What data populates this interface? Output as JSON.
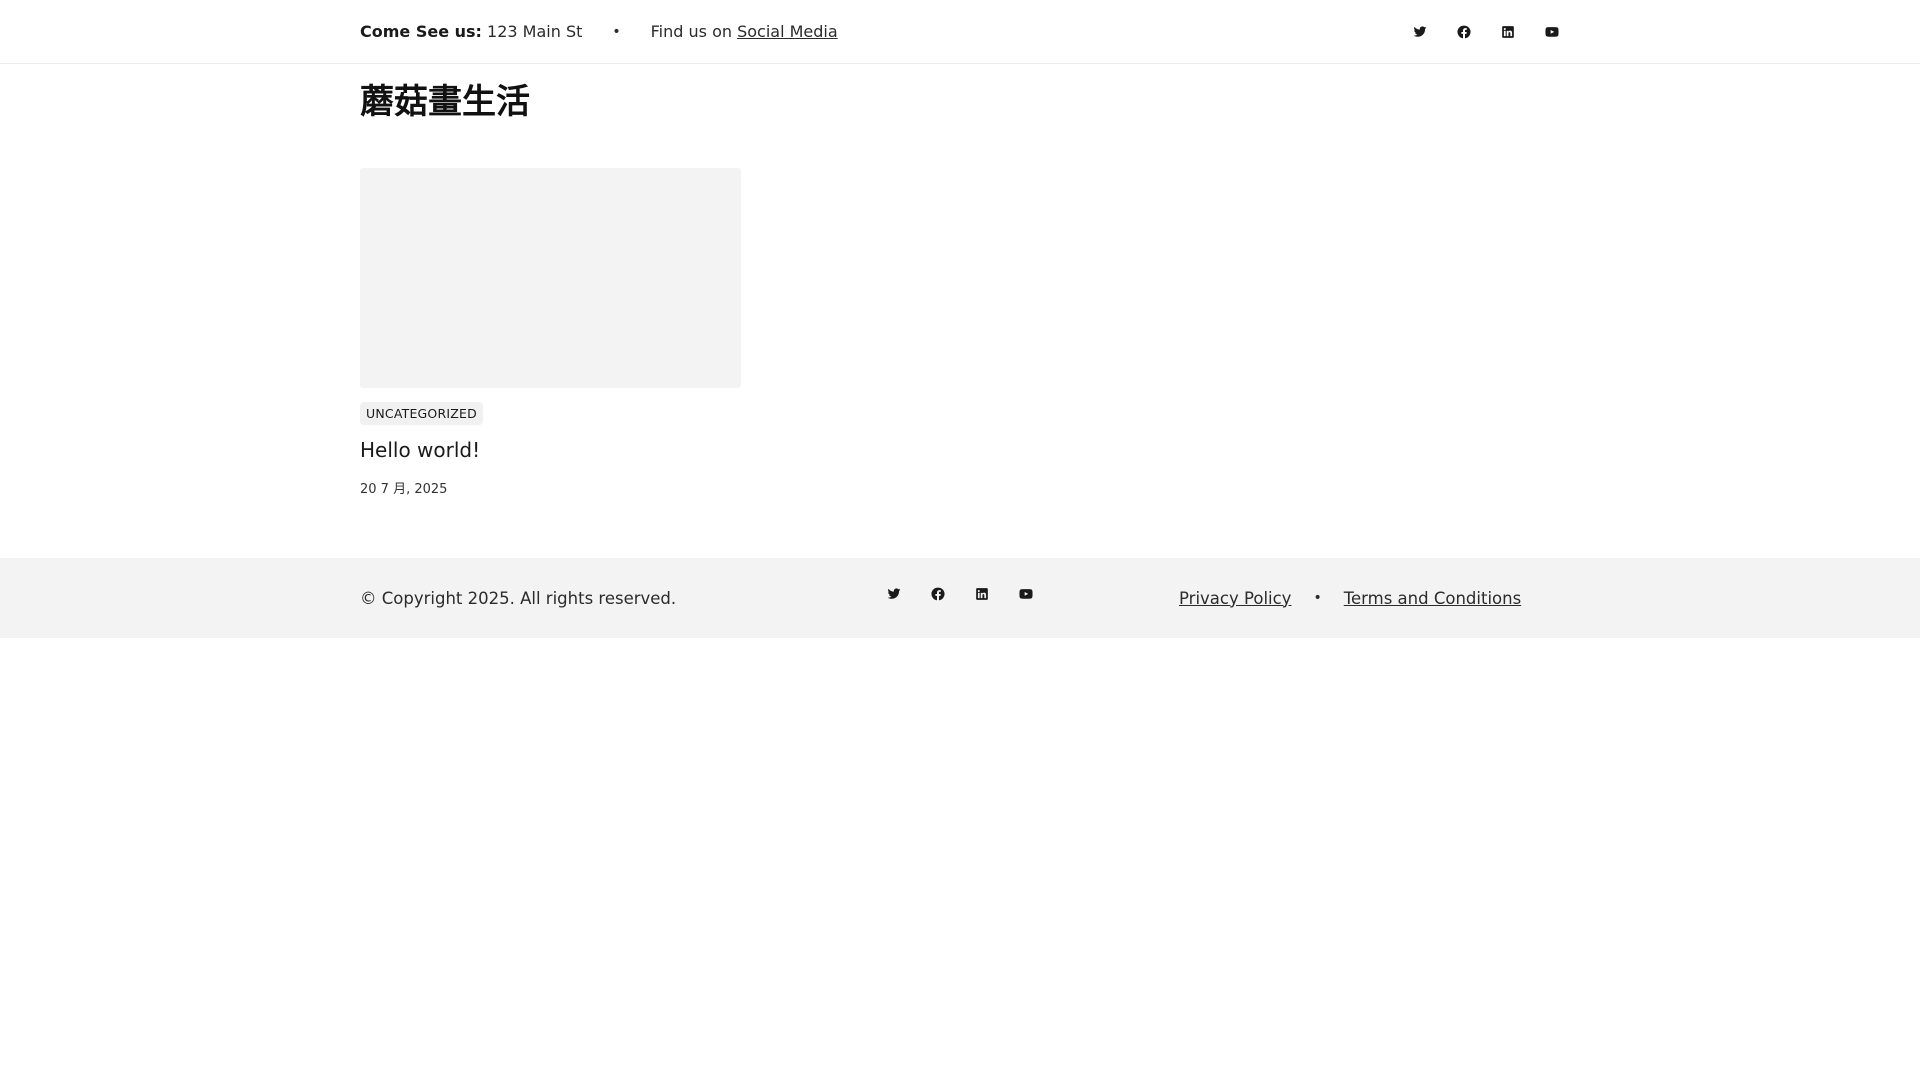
{
  "topbar": {
    "address_label": "Come See us:",
    "address_value": "123 Main St",
    "separator": "•",
    "social_prefix": "Find us on",
    "social_link": "Social Media",
    "icons": [
      "twitter-icon",
      "facebook-icon",
      "linkedin-icon",
      "youtube-icon"
    ]
  },
  "site_title": "蘑菇畫生活",
  "posts": [
    {
      "category": "UNCATEGORIZED",
      "title": "Hello world!",
      "date": "20 7 月, 2025"
    }
  ],
  "footer": {
    "copyright": "© Copyright 2025. All rights reserved.",
    "icons": [
      "twitter-icon",
      "facebook-icon",
      "linkedin-icon",
      "youtube-icon"
    ],
    "links": [
      "Privacy Policy",
      "Terms and Conditions"
    ],
    "separator": "•"
  }
}
